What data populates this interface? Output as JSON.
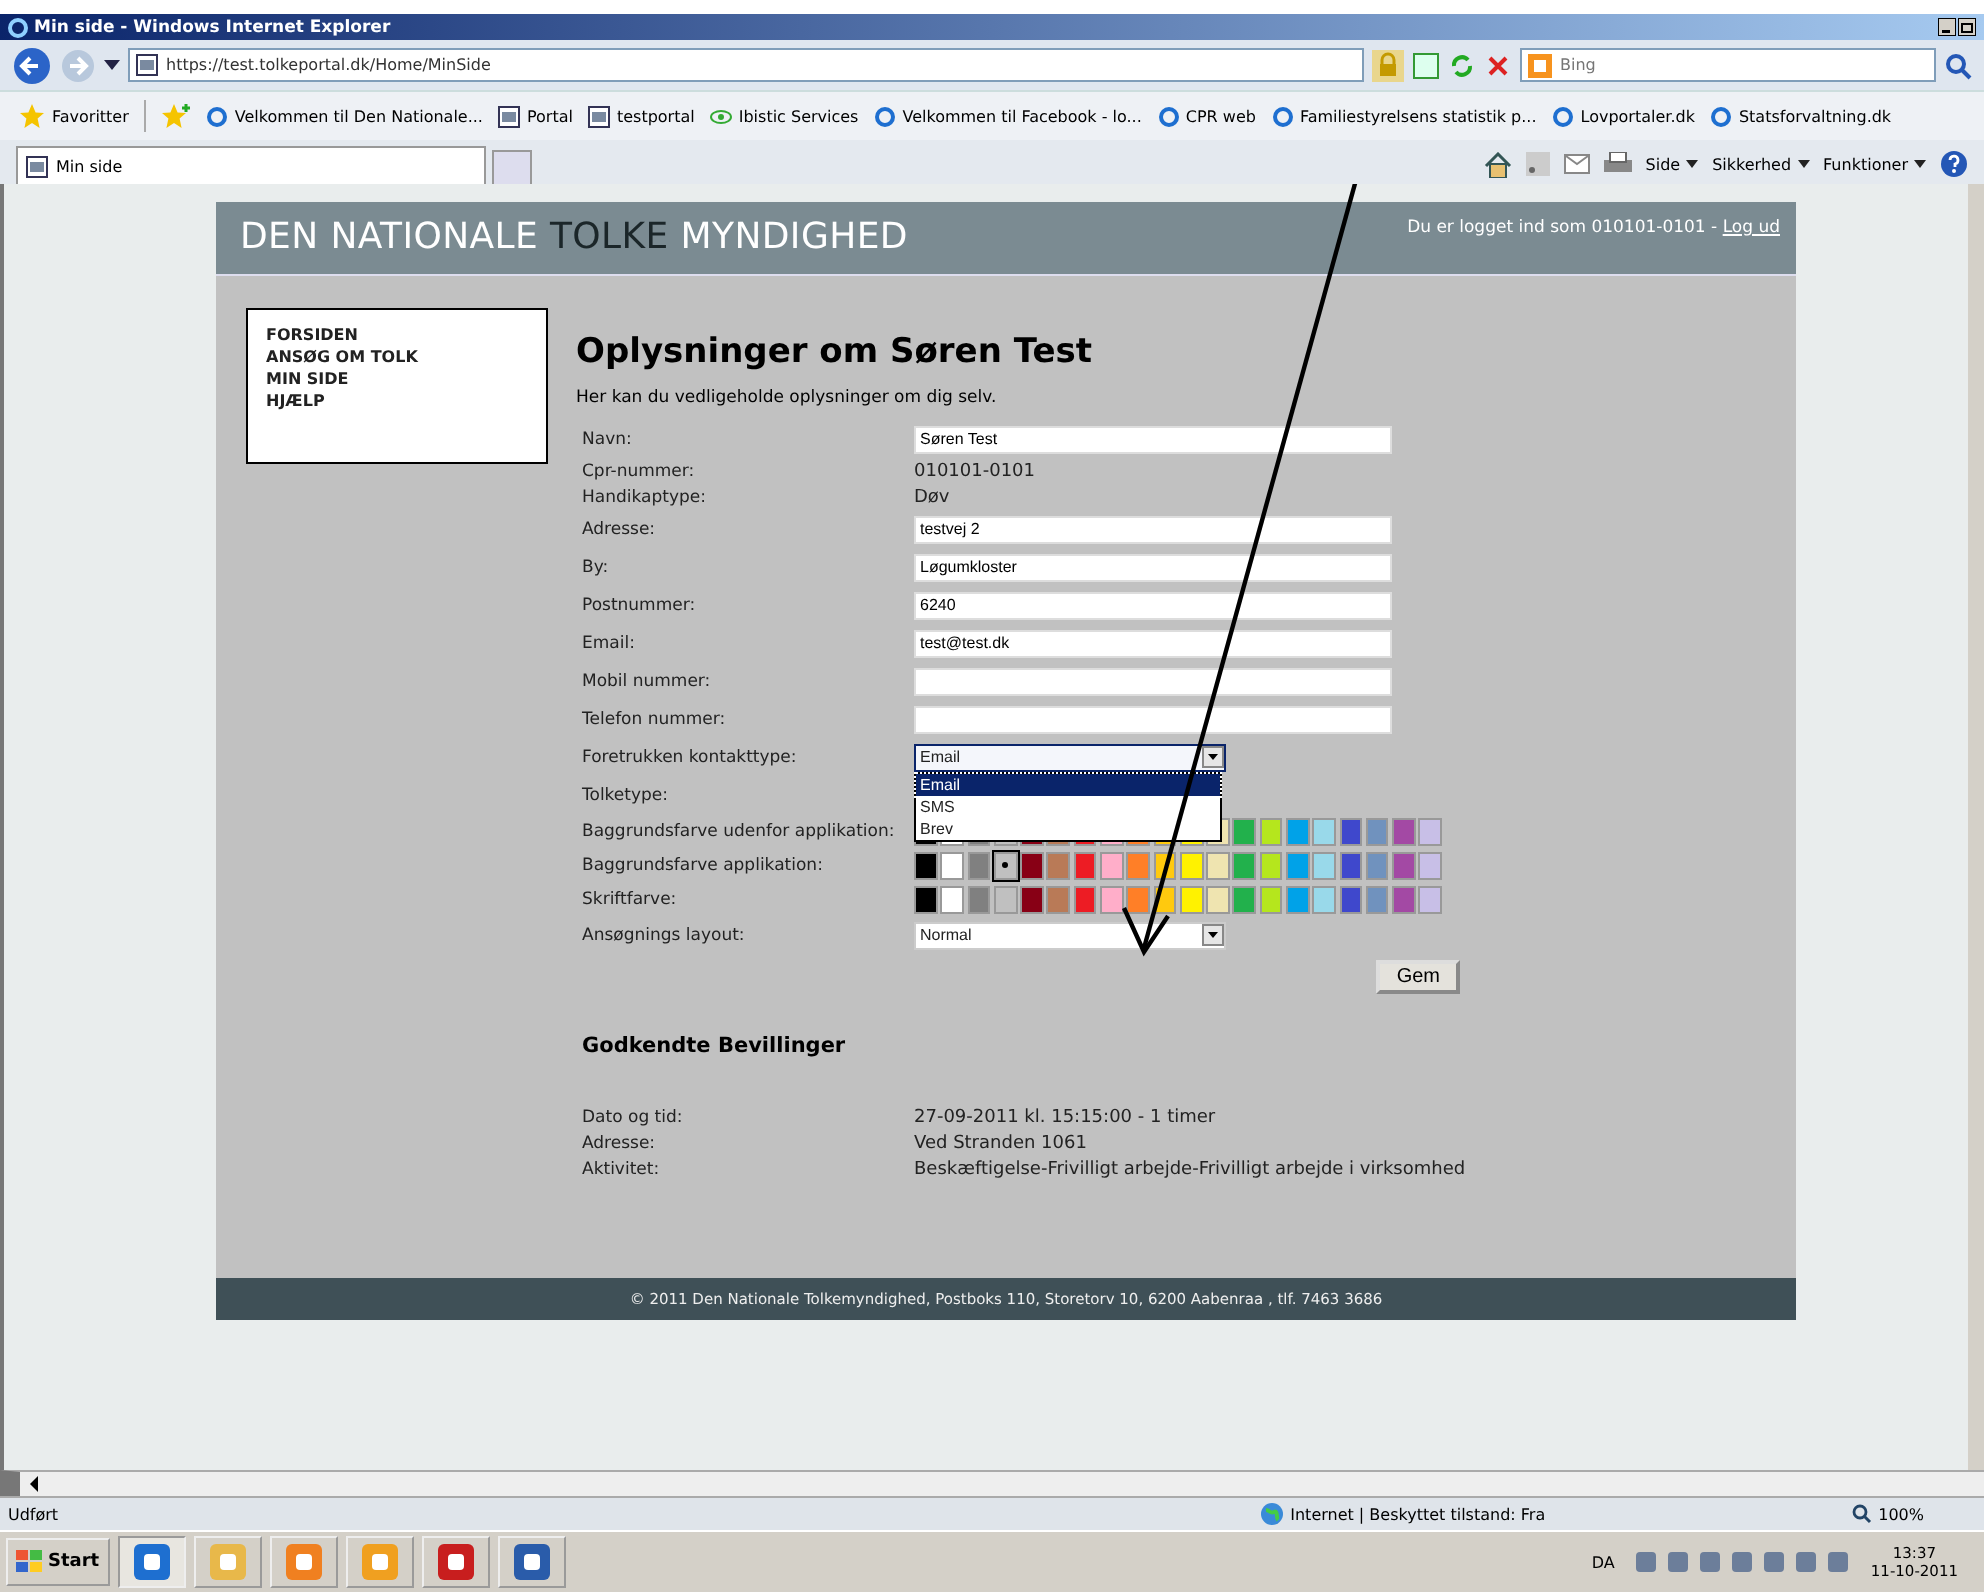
{
  "window": {
    "title": "Min side - Windows Internet Explorer"
  },
  "address_bar": {
    "url": "https://test.tolkeportal.dk/Home/MinSide",
    "search_placeholder": "Bing"
  },
  "favorites_bar": {
    "label": "Favoritter",
    "items": [
      {
        "label": "Velkommen til Den Nationale...",
        "kind": "ie"
      },
      {
        "label": "Portal",
        "kind": "site"
      },
      {
        "label": "testportal",
        "kind": "site"
      },
      {
        "label": "Ibistic Services",
        "kind": "eye"
      },
      {
        "label": "Velkommen til Facebook - lo...",
        "kind": "ie"
      },
      {
        "label": "CPR web",
        "kind": "ie"
      },
      {
        "label": "Familiestyrelsens statistik p...",
        "kind": "ie"
      },
      {
        "label": "Lovportaler.dk",
        "kind": "ie"
      },
      {
        "label": "Statsforvaltning.dk",
        "kind": "ie"
      }
    ]
  },
  "tab": {
    "label": "Min side"
  },
  "command_bar": [
    "Side",
    "Sikkerhed",
    "Funktioner"
  ],
  "site": {
    "title": [
      {
        "text": "DEN NATIONALE ",
        "highlight": false
      },
      {
        "text": "TOLKE",
        "highlight": true
      },
      {
        "text": " MYNDIGHED",
        "highlight": false
      }
    ],
    "login_text": "Du er logget ind som 010101-0101 - ",
    "logout_link": "Log ud",
    "nav": [
      "FORSIDEN",
      "ANSØG OM TOLK",
      "MIN SIDE",
      "HJÆLP"
    ],
    "heading": "Oplysninger om Søren Test",
    "intro": "Her kan du vedligeholde oplysninger om dig selv.",
    "fields": [
      {
        "kind": "input",
        "label": "Navn:",
        "value": "Søren Test"
      },
      {
        "kind": "text",
        "label": "Cpr-nummer:",
        "value": "010101-0101"
      },
      {
        "kind": "text",
        "label": "Handikaptype:",
        "value": "Døv"
      },
      {
        "kind": "input",
        "label": "Adresse:",
        "value": "testvej 2"
      },
      {
        "kind": "input",
        "label": "By:",
        "value": "Løgumkloster"
      },
      {
        "kind": "input",
        "label": "Postnummer:",
        "value": "6240"
      },
      {
        "kind": "input",
        "label": "Email:",
        "value": "test@test.dk"
      },
      {
        "kind": "input",
        "label": "Mobil nummer:"
      },
      {
        "kind": "input",
        "label": "Telefon nummer:"
      },
      {
        "kind": "select",
        "label": "Foretrukken kontakttype:",
        "value": "Email",
        "expanded": true,
        "options": [
          {
            "label": "Email",
            "selected": true
          },
          {
            "label": "SMS",
            "selected": false
          },
          {
            "label": "Brev",
            "selected": false
          }
        ]
      },
      {
        "kind": "label",
        "label": "Tolketype:"
      },
      {
        "kind": "colors",
        "label": "Baggrundsfarve udenfor applikation:",
        "swatches": [
          {
            "color": "#000000",
            "selected": false
          },
          {
            "color": "#ffffff",
            "selected": false
          },
          {
            "color": "#808080",
            "selected": false
          },
          {
            "color": "#c0c0c0",
            "selected": false
          },
          {
            "color": "#880015",
            "selected": false
          },
          {
            "color": "#b97a57",
            "selected": false
          },
          {
            "color": "#ed1c24",
            "selected": false
          },
          {
            "color": "#ffaec9",
            "selected": false
          },
          {
            "color": "#ff7f27",
            "selected": false
          },
          {
            "color": "#ffc90e",
            "selected": false
          },
          {
            "color": "#fff200",
            "selected": false
          },
          {
            "color": "#efe4b0",
            "selected": false
          },
          {
            "color": "#22b14c",
            "selected": false
          },
          {
            "color": "#b5e61d",
            "selected": false
          },
          {
            "color": "#00a2e8",
            "selected": false
          },
          {
            "color": "#99d9ea",
            "selected": false
          },
          {
            "color": "#3f48cc",
            "selected": false
          },
          {
            "color": "#7092be",
            "selected": false
          },
          {
            "color": "#a349a4",
            "selected": false
          },
          {
            "color": "#c8bfe7",
            "selected": false
          }
        ]
      },
      {
        "kind": "colors",
        "label": "Baggrundsfarve applikation:",
        "swatches": [
          {
            "color": "#000000",
            "selected": false
          },
          {
            "color": "#ffffff",
            "selected": false
          },
          {
            "color": "#808080",
            "selected": false
          },
          {
            "color": "#c0c0c0",
            "selected": true
          },
          {
            "color": "#880015",
            "selected": false
          },
          {
            "color": "#b97a57",
            "selected": false
          },
          {
            "color": "#ed1c24",
            "selected": false
          },
          {
            "color": "#ffaec9",
            "selected": false
          },
          {
            "color": "#ff7f27",
            "selected": false
          },
          {
            "color": "#ffc90e",
            "selected": false
          },
          {
            "color": "#fff200",
            "selected": false
          },
          {
            "color": "#efe4b0",
            "selected": false
          },
          {
            "color": "#22b14c",
            "selected": false
          },
          {
            "color": "#b5e61d",
            "selected": false
          },
          {
            "color": "#00a2e8",
            "selected": false
          },
          {
            "color": "#99d9ea",
            "selected": false
          },
          {
            "color": "#3f48cc",
            "selected": false
          },
          {
            "color": "#7092be",
            "selected": false
          },
          {
            "color": "#a349a4",
            "selected": false
          },
          {
            "color": "#c8bfe7",
            "selected": false
          }
        ]
      },
      {
        "kind": "colors",
        "label": "Skriftfarve:",
        "swatches": [
          {
            "color": "#000000",
            "selected": false
          },
          {
            "color": "#ffffff",
            "selected": false
          },
          {
            "color": "#808080",
            "selected": false
          },
          {
            "color": "#c0c0c0",
            "selected": false
          },
          {
            "color": "#880015",
            "selected": false
          },
          {
            "color": "#b97a57",
            "selected": false
          },
          {
            "color": "#ed1c24",
            "selected": false
          },
          {
            "color": "#ffaec9",
            "selected": false
          },
          {
            "color": "#ff7f27",
            "selected": false
          },
          {
            "color": "#ffc90e",
            "selected": false
          },
          {
            "color": "#fff200",
            "selected": false
          },
          {
            "color": "#efe4b0",
            "selected": false
          },
          {
            "color": "#22b14c",
            "selected": false
          },
          {
            "color": "#b5e61d",
            "selected": false
          },
          {
            "color": "#00a2e8",
            "selected": false
          },
          {
            "color": "#99d9ea",
            "selected": false
          },
          {
            "color": "#3f48cc",
            "selected": false
          },
          {
            "color": "#7092be",
            "selected": false
          },
          {
            "color": "#a349a4",
            "selected": false
          },
          {
            "color": "#c8bfe7",
            "selected": false
          }
        ]
      },
      {
        "kind": "select",
        "label": "Ansøgnings layout:",
        "value": "Normal"
      }
    ],
    "save_button": "Gem",
    "grants_heading": "Godkendte Bevillinger",
    "grants": [
      {
        "label": "Dato og tid:",
        "value": "27-09-2011 kl. 15:15:00 - 1 timer"
      },
      {
        "label": "Adresse:",
        "value": "Ved Stranden 1061"
      },
      {
        "label": "Aktivitet:",
        "value": "Beskæftigelse-Frivilligt arbejde-Frivilligt arbejde i virksomhed"
      }
    ],
    "footer": "© 2011 Den Nationale Tolkemyndighed, Postboks 110, Storetorv 10, 6200 Aabenraa , tlf. 7463 3686"
  },
  "status_bar": {
    "text": "Udført",
    "zone": "Internet | Beskyttet tilstand: Fra",
    "zoom": "100%"
  },
  "taskbar": {
    "start": "Start",
    "apps": [
      {
        "active": true
      },
      {
        "active": false
      },
      {
        "active": false
      },
      {
        "active": false
      },
      {
        "active": false
      },
      {
        "active": false
      }
    ],
    "language": "DA",
    "time": "13:37",
    "date": "11-10-2011"
  }
}
